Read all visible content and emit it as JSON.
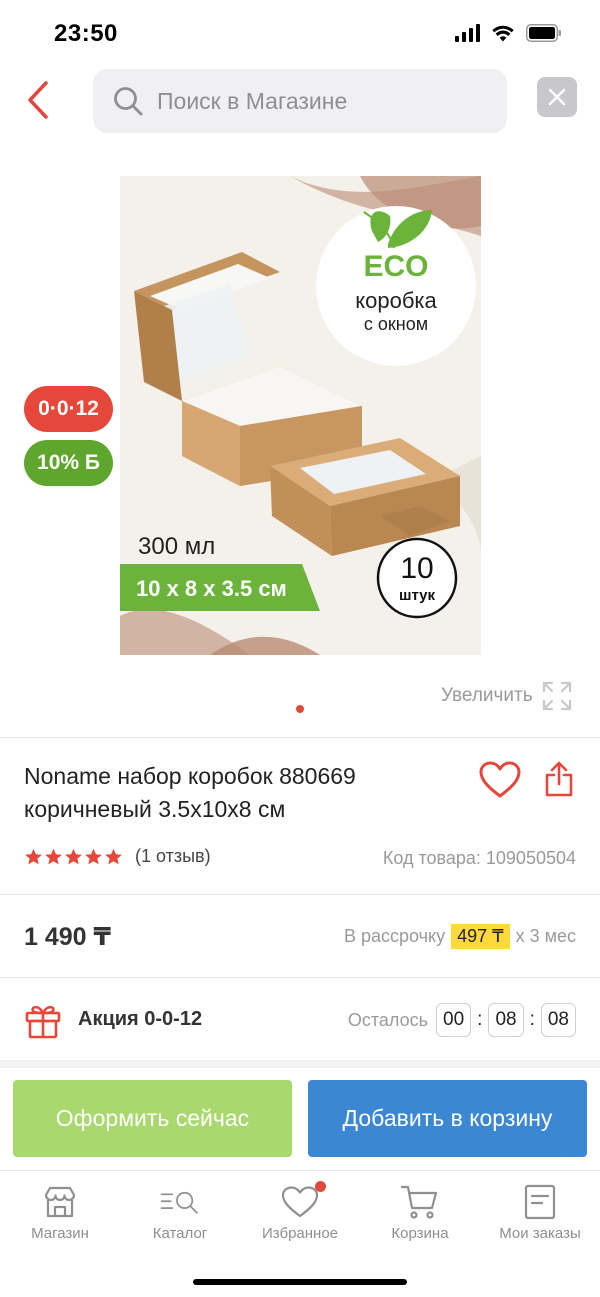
{
  "status_bar": {
    "time": "23:50"
  },
  "header": {
    "search_placeholder": "Поиск в Магазине"
  },
  "product_image": {
    "eco_label": "ECO",
    "box_line1": "коробка",
    "box_line2": "с окном",
    "volume": "300 мл",
    "dimensions": "10 x 8 x 3.5 см",
    "count_number": "10",
    "count_unit": "штук"
  },
  "badges": {
    "installment": "0·0·12",
    "bonus": "10% Б"
  },
  "gallery": {
    "zoom_label": "Увеличить",
    "current_page": 1,
    "total_pages": 1
  },
  "product": {
    "title": "Noname набор коробок 880669 коричневый 3.5x10x8 см",
    "rating": 5,
    "reviews": "(1 отзыв)",
    "sku": "Код товара: 109050504",
    "price": "1 490 ₸",
    "installment_prefix": "В рассрочку",
    "installment_amount": "497 ₸",
    "installment_suffix": "x 3 мес"
  },
  "promo": {
    "label": "Акция 0-0-12",
    "remaining_label": "Осталось",
    "hours": "00",
    "minutes": "08",
    "seconds": "08"
  },
  "actions": {
    "checkout": "Оформить сейчас",
    "add_to_cart": "Добавить в корзину"
  },
  "tabs": [
    {
      "label": "Магазин",
      "icon": "store-icon"
    },
    {
      "label": "Каталог",
      "icon": "catalog-search-icon"
    },
    {
      "label": "Избранное",
      "icon": "heart-icon"
    },
    {
      "label": "Корзина",
      "icon": "cart-icon"
    },
    {
      "label": "Мои заказы",
      "icon": "orders-icon"
    }
  ],
  "colors": {
    "accent_red": "#e5483b",
    "accent_green": "#5ea62d",
    "checkout_green": "#a9d96e",
    "cart_blue": "#3c87d4",
    "highlight_yellow": "#ffd93b"
  }
}
